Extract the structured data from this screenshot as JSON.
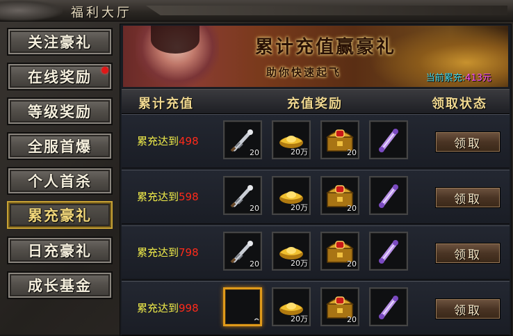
{
  "window": {
    "title": "福利大厅"
  },
  "sidebar": {
    "items": [
      {
        "label": "关注豪礼",
        "active": false,
        "red_dot": false
      },
      {
        "label": "在线奖励",
        "active": false,
        "red_dot": true
      },
      {
        "label": "等级奖励",
        "active": false,
        "red_dot": false
      },
      {
        "label": "全服首爆",
        "active": false,
        "red_dot": false
      },
      {
        "label": "个人首杀",
        "active": false,
        "red_dot": false
      },
      {
        "label": "累充豪礼",
        "active": true,
        "red_dot": false
      },
      {
        "label": "日充豪礼",
        "active": false,
        "red_dot": false
      },
      {
        "label": "成长基金",
        "active": false,
        "red_dot": false
      }
    ]
  },
  "banner": {
    "title": "累计充值赢豪礼",
    "subtitle": "助你快速起飞",
    "current_label": "当前累充:",
    "current_value": "413元"
  },
  "table": {
    "headers": [
      "累计充值",
      "充值奖励",
      "领取状态"
    ],
    "rows": [
      {
        "prefix": "累充达到",
        "amount": "498",
        "items": [
          {
            "icon": "silver-sword-icon",
            "count": "20",
            "highlighted": false
          },
          {
            "icon": "gold-ingot-icon",
            "count": "20万",
            "highlighted": false
          },
          {
            "icon": "treasure-chest-icon",
            "count": "20",
            "highlighted": false
          },
          {
            "icon": "purple-scroll-icon",
            "count": "",
            "highlighted": false
          }
        ],
        "button": "领取"
      },
      {
        "prefix": "累充达到",
        "amount": "598",
        "items": [
          {
            "icon": "silver-sword-icon",
            "count": "20",
            "highlighted": false
          },
          {
            "icon": "gold-ingot-icon",
            "count": "20万",
            "highlighted": false
          },
          {
            "icon": "treasure-chest-icon",
            "count": "20",
            "highlighted": false
          },
          {
            "icon": "purple-scroll-icon",
            "count": "",
            "highlighted": false
          }
        ],
        "button": "领取"
      },
      {
        "prefix": "累充达到",
        "amount": "798",
        "items": [
          {
            "icon": "silver-sword-icon",
            "count": "20",
            "highlighted": false
          },
          {
            "icon": "gold-ingot-icon",
            "count": "20万",
            "highlighted": false
          },
          {
            "icon": "treasure-chest-icon",
            "count": "20",
            "highlighted": false
          },
          {
            "icon": "purple-scroll-icon",
            "count": "",
            "highlighted": false
          }
        ],
        "button": "领取"
      },
      {
        "prefix": "累充达到",
        "amount": "998",
        "items": [
          {
            "icon": "empty-slot-icon",
            "count": "",
            "highlighted": true
          },
          {
            "icon": "gold-ingot-icon",
            "count": "20万",
            "highlighted": false
          },
          {
            "icon": "treasure-chest-icon",
            "count": "20",
            "highlighted": false
          },
          {
            "icon": "purple-scroll-icon",
            "count": "",
            "highlighted": false
          }
        ],
        "button": "领取"
      }
    ]
  },
  "colors": {
    "accent_gold": "#f0d890",
    "amount_red": "#ff2a1a",
    "req_yellow": "#f2ee4a",
    "active_border": "#c8a234",
    "current_value": "#ff50ff"
  }
}
